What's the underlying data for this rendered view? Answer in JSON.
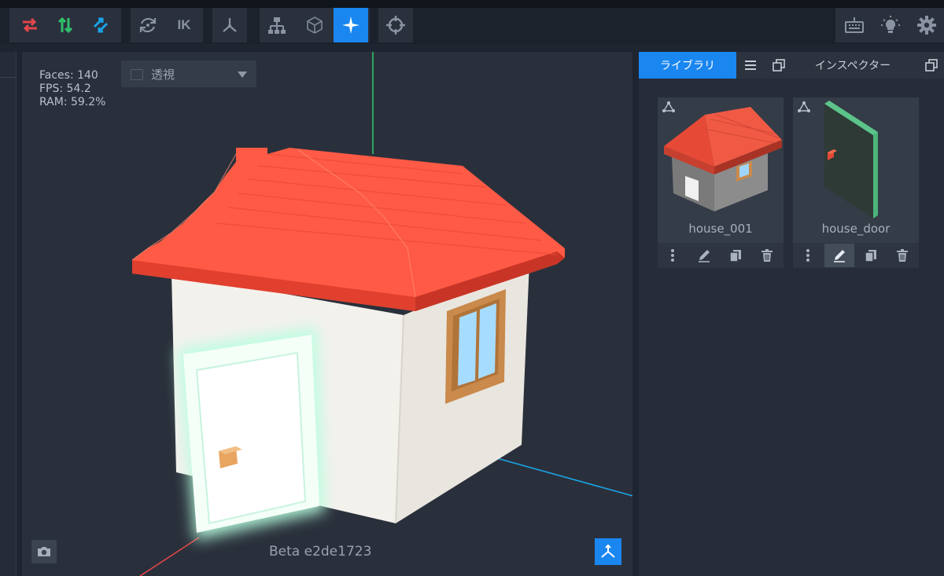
{
  "toolbar": {
    "buttons": [
      {
        "id": "swap-horizontal",
        "icon": "swap-horizontal-icon",
        "color": "#e2454a"
      },
      {
        "id": "swap-vertical",
        "icon": "swap-vertical-icon",
        "color": "#2fc06a"
      },
      {
        "id": "swap-diagonal",
        "icon": "swap-diagonal-icon",
        "color": "#1aa3e6"
      },
      {
        "id": "rotate",
        "icon": "rotate-icon"
      },
      {
        "id": "ik",
        "label": "IK"
      },
      {
        "id": "pivot",
        "icon": "pivot-icon"
      },
      {
        "id": "hierarchy",
        "icon": "hierarchy-icon"
      },
      {
        "id": "cube",
        "icon": "cube-icon"
      },
      {
        "id": "sparkle",
        "icon": "sparkle-icon",
        "active": true
      },
      {
        "id": "target",
        "icon": "crosshair-icon"
      },
      {
        "id": "keyboard",
        "icon": "keyboard-icon"
      },
      {
        "id": "lightbulb",
        "icon": "lightbulb-icon"
      },
      {
        "id": "settings",
        "icon": "gear-icon"
      }
    ]
  },
  "viewport": {
    "stats": {
      "faces": "Faces: 140",
      "fps": "FPS: 54.2",
      "ram": "RAM: 59.2%"
    },
    "view_mode": "透視",
    "version": "Beta e2de1723",
    "colors": {
      "roof": "#ff5a45",
      "wall": "#f1eee8",
      "door_glow": "#b8ffe0",
      "window_frame": "#c98a4c",
      "window_glass": "#a6dcff",
      "axis_y": "#2fc06a",
      "axis_x": "#e2454a",
      "axis_z": "#1aa3e6"
    }
  },
  "panel": {
    "tabs": {
      "library": "ライブラリ",
      "inspector": "インスペクター"
    },
    "items": [
      {
        "name": "house_001"
      },
      {
        "name": "house_door",
        "selected_action": "edit"
      }
    ]
  },
  "accent": "#1a86f0"
}
